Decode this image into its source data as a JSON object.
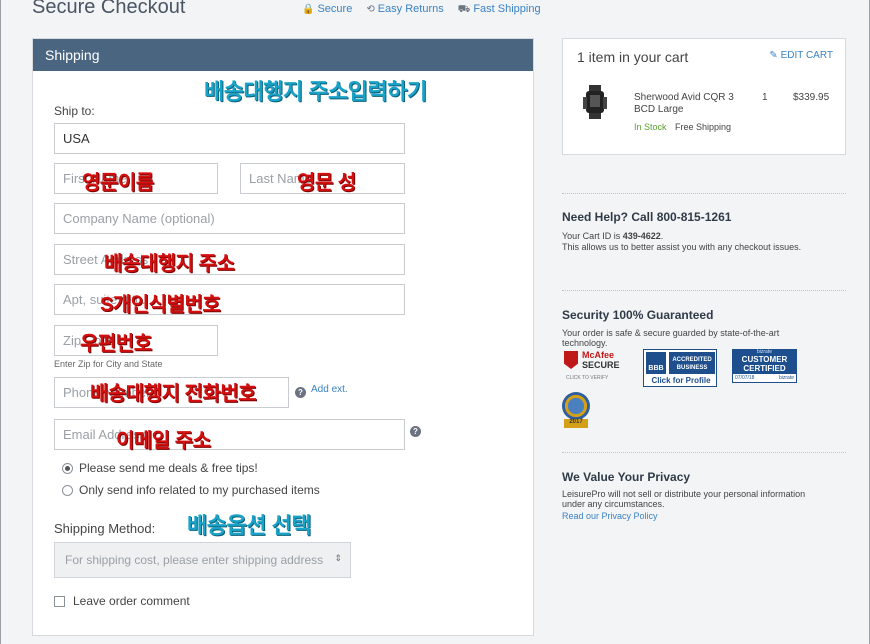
{
  "header": {
    "title": "Secure Checkout",
    "badges": [
      "Secure",
      "Easy Returns",
      "Fast Shipping"
    ]
  },
  "shipping": {
    "panel_title": "Shipping",
    "ship_to_label": "Ship to:",
    "country_value": "USA",
    "first_name_placeholder": "First Name",
    "last_name_placeholder": "Last Name",
    "company_placeholder": "Company Name (optional)",
    "street_placeholder": "Street Address",
    "apt_placeholder": "Apt, suite, etc.",
    "zip_placeholder": "Zip Code",
    "zip_help": "Enter Zip for City and State",
    "phone_placeholder": "Phone Number",
    "add_ext": "Add ext.",
    "email_placeholder": "Email Address",
    "radio_deals": "Please send me deals & free tips!",
    "radio_info": "Only send info related to my purchased items",
    "method_label": "Shipping Method:",
    "method_placeholder": "For shipping cost, please enter shipping address",
    "comment_label": "Leave order comment"
  },
  "annotations": {
    "title_note": "배송대행지 주소입력하기",
    "first_name": "영문이름",
    "last_name": "영문 성",
    "street": "배송대행지 주소",
    "apt": "S개인식별번호",
    "zip": "우편번호",
    "phone": "배송대행지 전화번호",
    "email": "이메일 주소",
    "method": "배송옵션 선택"
  },
  "cart": {
    "title": "1 item in your cart",
    "edit": "EDIT CART",
    "product_name": "Sherwood Avid CQR 3 BCD Large",
    "qty": "1",
    "price": "$339.95",
    "stock": "In Stock",
    "shipping": "Free Shipping"
  },
  "help": {
    "heading": "Need Help? Call 800-815-1261",
    "cart_id_prefix": "Your Cart ID is ",
    "cart_id": "439-4622",
    "text": "This allows us to better assist you with any checkout issues."
  },
  "security": {
    "heading": "Security 100% Guaranteed",
    "text": "Your order is safe & secure guarded by state-of-the-art technology.",
    "mcafee_line1": "McAfee",
    "mcafee_line2": "SECURE",
    "mcafee_sub": "CLICK TO VERIFY",
    "bbb_line1": "ACCREDITED",
    "bbb_line2": "BUSINESS",
    "bbb_sub": "Click for Profile",
    "bizrate_top": "bizrate",
    "bizrate_line1": "CUSTOMER",
    "bizrate_line2": "CERTIFIED",
    "bizrate_sub1": "07/07/18",
    "bizrate_sub2": "bizrate",
    "award_year": "2017"
  },
  "privacy": {
    "heading": "We Value Your Privacy",
    "text": "LeisurePro will not sell or distribute your personal information under any circumstances.",
    "link": "Read our Privacy Policy"
  },
  "colors": {
    "panel_header": "#4a6580",
    "link": "#3b82c4",
    "annotation_red": "#d30f0f",
    "annotation_teal": "#1aa3c9"
  }
}
